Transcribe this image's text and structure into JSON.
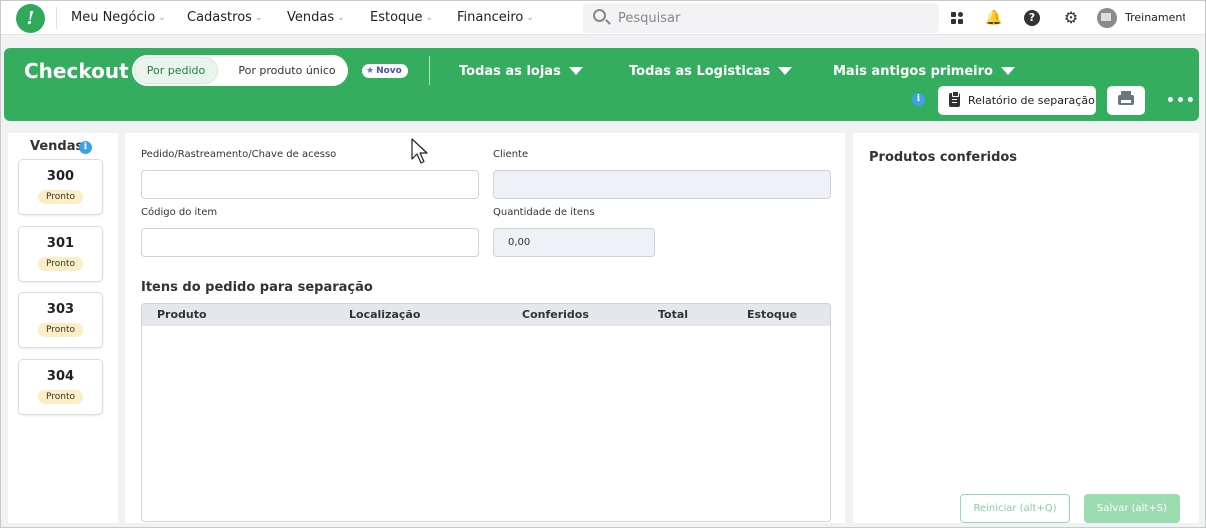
{
  "topnav": {
    "items": [
      {
        "label": "Meu Negócio"
      },
      {
        "label": "Cadastros"
      },
      {
        "label": "Vendas"
      },
      {
        "label": "Estoque"
      },
      {
        "label": "Financeiro"
      }
    ],
    "search_placeholder": "Pesquisar",
    "user_name": "Treinamento"
  },
  "header": {
    "title": "Checkout",
    "toggle": {
      "active": "Por pedido",
      "other": "Por produto único"
    },
    "badge": "Novo",
    "filters": {
      "stores": "Todas as lojas",
      "logistics": "Todas as Logisticas",
      "sort": "Mais antigos primeiro"
    },
    "report_button": "Relatório de separação",
    "colors": {
      "brand_green": "#34ae5e"
    }
  },
  "sidebar": {
    "title": "Vendas",
    "sales": [
      {
        "number": "300",
        "status": "Pronto"
      },
      {
        "number": "301",
        "status": "Pronto"
      },
      {
        "number": "303",
        "status": "Pronto"
      },
      {
        "number": "304",
        "status": "Pronto"
      }
    ]
  },
  "form": {
    "order_label": "Pedido/Rastreamento/Chave de acesso",
    "order_value": "",
    "client_label": "Cliente",
    "client_value": "",
    "item_code_label": "Código do item",
    "item_code_value": "",
    "quantity_label": "Quantidade de itens",
    "quantity_value": "0,00"
  },
  "table": {
    "title": "Itens do pedido para separação",
    "columns": [
      "Produto",
      "Localização",
      "Conferidos",
      "Total",
      "Estoque"
    ],
    "rows": []
  },
  "right_panel": {
    "title": "Produtos conferidos",
    "reset_button": "Reiniciar (alt+Q)",
    "save_button": "Salvar (alt+S)"
  }
}
